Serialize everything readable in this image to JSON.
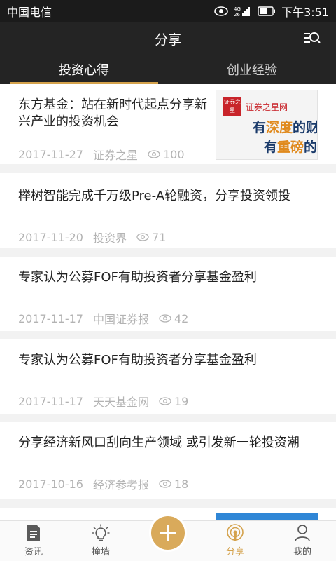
{
  "status_bar": {
    "carrier": "中国电信",
    "time": "下午3:51",
    "network": "4G"
  },
  "header": {
    "title": "分享"
  },
  "tabs": [
    {
      "label": "投资心得",
      "active": true
    },
    {
      "label": "创业经验",
      "active": false
    }
  ],
  "articles": [
    {
      "title": "东方基金：站在新时代起点分享新兴产业的投资机会",
      "date": "2017-11-27",
      "source": "证券之星",
      "views": "100",
      "thumbnail": {
        "brand": "证券之星网",
        "logo": "证券之星",
        "line1_pre": "有",
        "line1_hl": "深度",
        "line1_post": "的财经",
        "line2_pre": "有",
        "line2_hl": "重磅",
        "line2_post": "的财经"
      }
    },
    {
      "title": "榉树智能完成千万级Pre-A轮融资，分享投资领投",
      "date": "2017-11-20",
      "source": "投资界",
      "views": "71"
    },
    {
      "title": "专家认为公募FOF有助投资者分享基金盈利",
      "date": "2017-11-17",
      "source": "中国证券报",
      "views": "42"
    },
    {
      "title": "专家认为公募FOF有助投资者分享基金盈利",
      "date": "2017-11-17",
      "source": "天天基金网",
      "views": "19"
    },
    {
      "title": "分享经济新风口刮向生产领域 或引发新一轮投资潮",
      "date": "2017-10-16",
      "source": "经济参考报",
      "views": "18"
    }
  ],
  "bottom_nav": [
    {
      "label": "资讯",
      "icon": "document-icon"
    },
    {
      "label": "撞墙",
      "icon": "lightbulb-icon"
    },
    {
      "label": "",
      "icon": "plus-icon"
    },
    {
      "label": "分享",
      "icon": "broadcast-icon",
      "active": true
    },
    {
      "label": "我的",
      "icon": "person-icon"
    }
  ],
  "colors": {
    "accent": "#d4a24c",
    "dark_bar": "#242424",
    "meta_text": "#b3b3b3"
  }
}
